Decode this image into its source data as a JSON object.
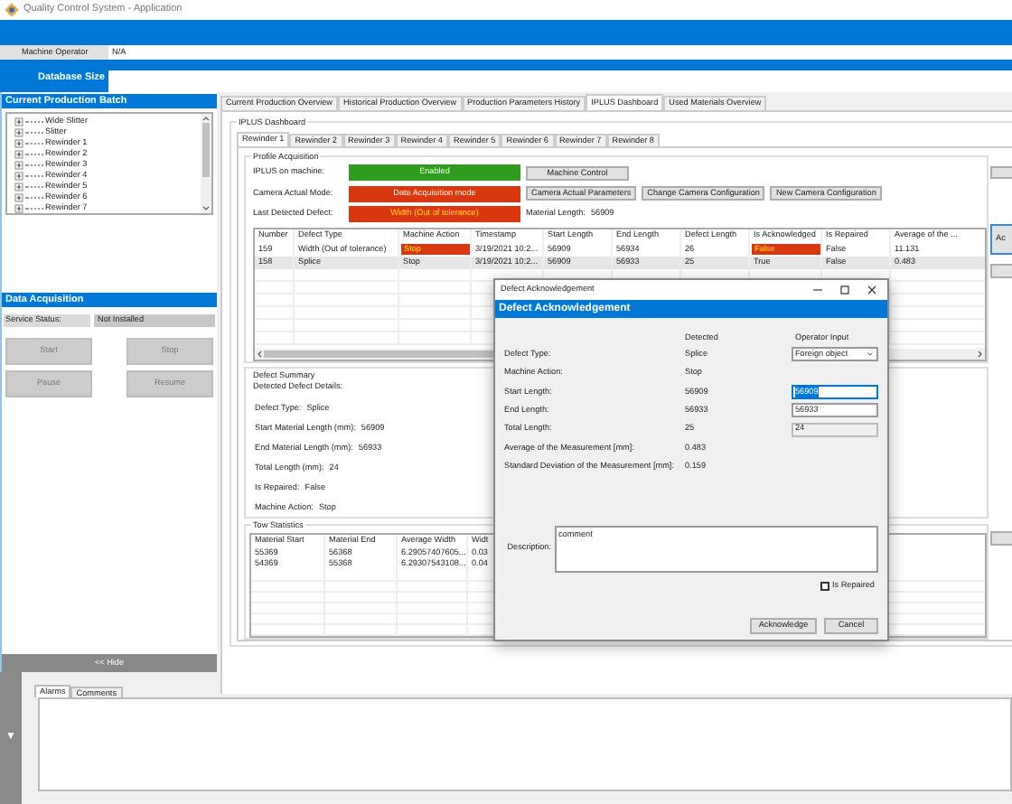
{
  "window": {
    "title": "Quality Control System - Application"
  },
  "header": {
    "operator_label": "Machine Operator",
    "operator_value": "N/A",
    "database_label": "Database Size"
  },
  "batch_panel": {
    "title": "Current Production Batch",
    "tree": [
      {
        "label": "Wide Slitter"
      },
      {
        "label": "Slitter"
      },
      {
        "label": "Rewinder 1"
      },
      {
        "label": "Rewinder 2"
      },
      {
        "label": "Rewinder 3"
      },
      {
        "label": "Rewinder 4"
      },
      {
        "label": "Rewinder 5"
      },
      {
        "label": "Rewinder 6"
      },
      {
        "label": "Rewinder 7"
      }
    ]
  },
  "acquisition_panel": {
    "title": "Data Acquisition",
    "status_label": "Service Status:",
    "status_value": "Not Installed",
    "buttons": [
      {
        "label": "Start",
        "disabled": true
      },
      {
        "label": "Stop",
        "disabled": true
      },
      {
        "label": "Pause",
        "disabled": true
      },
      {
        "label": "Resume",
        "disabled": true
      }
    ],
    "hide_button": "<< Hide"
  },
  "main_tabs": [
    {
      "label": "Current Production Overview",
      "selected": false
    },
    {
      "label": "Historical Production Overview",
      "selected": false
    },
    {
      "label": "Production Parameters History",
      "selected": false
    },
    {
      "label": "IPLUS Dashboard",
      "selected": true
    },
    {
      "label": "Used Materials Overview",
      "selected": false
    }
  ],
  "dashboard": {
    "title": "IPLUS Dashboard",
    "rewinder_tabs": [
      {
        "label": "Rewinder 1",
        "selected": true
      },
      {
        "label": "Rewinder 2",
        "selected": false
      },
      {
        "label": "Rewinder 3",
        "selected": false
      },
      {
        "label": "Rewinder 4",
        "selected": false
      },
      {
        "label": "Rewinder 5",
        "selected": false
      },
      {
        "label": "Rewinder 6",
        "selected": false
      },
      {
        "label": "Rewinder 7",
        "selected": false
      },
      {
        "label": "Rewinder 8",
        "selected": false
      }
    ],
    "profile": {
      "title": "Profile Acquisition",
      "rows": [
        {
          "label": "IPLUS on machine:",
          "status": "Enabled",
          "color": "#2e9c1c",
          "kind": "status",
          "buttons": [
            "Machine Control"
          ]
        },
        {
          "label": "Camera Actual Mode:",
          "status": "Data Acquisition mode",
          "color": "#d9380e",
          "kind": "status",
          "buttons": [
            "Camera Actual Parameters",
            "Change Camera Configuration",
            "New Camera Configuration"
          ]
        },
        {
          "label": "Last Detected Defect:",
          "status": "Width (Out of tolerance)",
          "color": "#d9380e",
          "kind": "alert",
          "extra_label": "Material Length:",
          "extra_value": "56909"
        }
      ]
    },
    "side_button": "Ac",
    "defects_table": {
      "columns": [
        "Number",
        "Defect Type",
        "Machine Action",
        "Timestamp",
        "Start Length",
        "End Length",
        "Defect Length",
        "Is Acknowledged",
        "Is Repaired",
        "Average of the ..."
      ],
      "rows": [
        {
          "selected": false,
          "cells": [
            {
              "text": "159",
              "alert": false
            },
            {
              "text": "Width (Out of tolerance)",
              "alert": false
            },
            {
              "text": "Stop",
              "alert": true
            },
            {
              "text": "3/19/2021 10:2...",
              "alert": false
            },
            {
              "text": "56909",
              "alert": false
            },
            {
              "text": "56934",
              "alert": false
            },
            {
              "text": "26",
              "alert": false
            },
            {
              "text": "False",
              "alert": true
            },
            {
              "text": "False",
              "alert": false
            },
            {
              "text": "11.131",
              "alert": false
            }
          ]
        },
        {
          "selected": true,
          "cells": [
            {
              "text": "158",
              "alert": false
            },
            {
              "text": "Splice",
              "alert": false
            },
            {
              "text": "Stop",
              "alert": false
            },
            {
              "text": "3/19/2021 10:2...",
              "alert": false
            },
            {
              "text": "56909",
              "alert": false
            },
            {
              "text": "56933",
              "alert": false
            },
            {
              "text": "25",
              "alert": false
            },
            {
              "text": "True",
              "alert": false
            },
            {
              "text": "False",
              "alert": false
            },
            {
              "text": "0.483",
              "alert": false
            }
          ]
        }
      ]
    },
    "defect_summary": {
      "title": "Defect Summary",
      "subtitle": "Detected Defect Details:",
      "fields": [
        {
          "label": "Defect Type:",
          "value": "Splice"
        },
        {
          "label": "Start Material Length (mm):",
          "value": "56909"
        },
        {
          "label": "End Material Length (mm):",
          "value": "56933"
        },
        {
          "label": "Total Length (mm):",
          "value": "24"
        },
        {
          "label": "Is Repaired:",
          "value": "False"
        },
        {
          "label": "Machine Action:",
          "value": "Stop"
        }
      ]
    },
    "tow_statistics": {
      "title": "Tow Statistics",
      "columns": [
        "Material Start",
        "Material End",
        "Average Width",
        "Widt"
      ],
      "rows": [
        [
          "55369",
          "56368",
          "6.29057407605...",
          "0.03"
        ],
        [
          "54369",
          "55368",
          "6.29307543108...",
          "0.04"
        ]
      ]
    }
  },
  "dialog": {
    "title": "Defect Acknowledgement",
    "header": "Defect Acknowledgement",
    "detected_heading": "Detected",
    "input_heading": "Operator Input",
    "fields": [
      {
        "label": "Defect Type:",
        "detected": "Splice",
        "kind": "dropdown",
        "input": "Foreign object"
      },
      {
        "label": "Machine Action:",
        "detected": "Stop",
        "kind": "none"
      },
      {
        "label": "Start Length:",
        "detected": "56909",
        "kind": "input",
        "input": "56909",
        "text_selected": true
      },
      {
        "label": "End Length:",
        "detected": "56933",
        "kind": "input",
        "input": "56933",
        "text_selected": false
      },
      {
        "label": "Total Length:",
        "detected": "25",
        "kind": "readonly",
        "input": "24"
      },
      {
        "label": "Average of the Measurement [mm]:",
        "detected": "0.483",
        "kind": "none"
      },
      {
        "label": "Standard Deviation of the Measurement [mm]:",
        "detected": "0.159",
        "kind": "none"
      }
    ],
    "description_label": "Description:",
    "description": "comment",
    "repaired_label": "Is Repaired",
    "repaired": false,
    "buttons": [
      "Acknowledge",
      "Cancel"
    ]
  },
  "bottom": {
    "collapse_glyph": "▼",
    "tabs": [
      {
        "label": "Alarms",
        "selected": true
      },
      {
        "label": "Comments",
        "selected": false
      }
    ]
  }
}
